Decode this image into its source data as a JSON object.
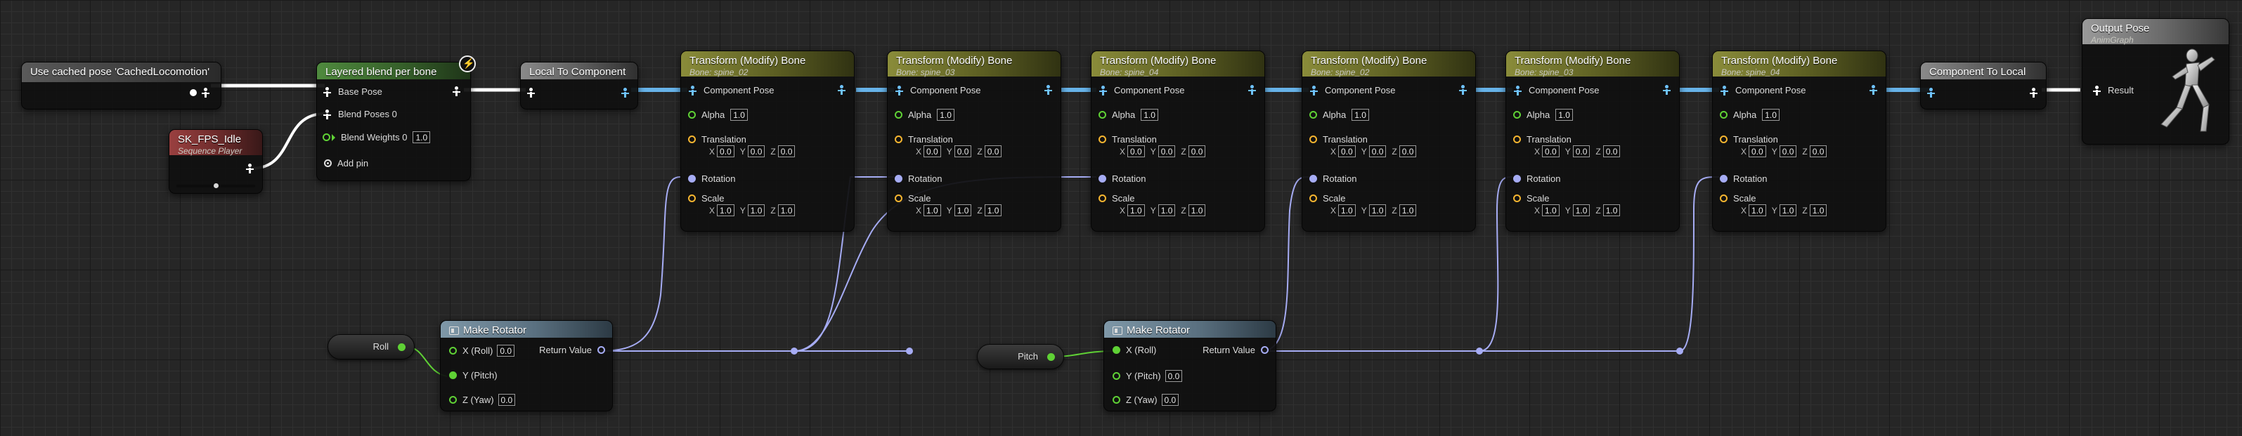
{
  "use_cached": {
    "title": "Use cached pose 'CachedLocomotion'"
  },
  "sequence_player": {
    "title": "SK_FPS_Idle",
    "subtitle": "Sequence Player",
    "play_position": 0.5
  },
  "layered_blend": {
    "title": "Layered blend per bone",
    "base_pose": "Base Pose",
    "blend_poses": "Blend Poses 0",
    "blend_weights": "Blend Weights 0",
    "blend_weights_value": "1.0",
    "add_pin": "Add pin"
  },
  "local_to_component": {
    "title": "Local To Component"
  },
  "component_to_local": {
    "title": "Component To Local"
  },
  "output_pose": {
    "title": "Output Pose",
    "subtitle": "AnimGraph",
    "result": "Result"
  },
  "transform_labels": {
    "component_pose": "Component Pose",
    "alpha": "Alpha",
    "translation": "Translation",
    "rotation": "Rotation",
    "scale": "Scale",
    "x": "X",
    "y": "Y",
    "z": "Z"
  },
  "transform_nodes": [
    {
      "title": "Transform (Modify) Bone",
      "bone": "Bone: spine_02",
      "alpha": "1.0",
      "translation": [
        "0.0",
        "0.0",
        "0.0"
      ],
      "scale": [
        "1.0",
        "1.0",
        "1.0"
      ]
    },
    {
      "title": "Transform (Modify) Bone",
      "bone": "Bone: spine_03",
      "alpha": "1.0",
      "translation": [
        "0.0",
        "0.0",
        "0.0"
      ],
      "scale": [
        "1.0",
        "1.0",
        "1.0"
      ]
    },
    {
      "title": "Transform (Modify) Bone",
      "bone": "Bone: spine_04",
      "alpha": "1.0",
      "translation": [
        "0.0",
        "0.0",
        "0.0"
      ],
      "scale": [
        "1.0",
        "1.0",
        "1.0"
      ]
    },
    {
      "title": "Transform (Modify) Bone",
      "bone": "Bone: spine_02",
      "alpha": "1.0",
      "translation": [
        "0.0",
        "0.0",
        "0.0"
      ],
      "scale": [
        "1.0",
        "1.0",
        "1.0"
      ]
    },
    {
      "title": "Transform (Modify) Bone",
      "bone": "Bone: spine_03",
      "alpha": "1.0",
      "translation": [
        "0.0",
        "0.0",
        "0.0"
      ],
      "scale": [
        "1.0",
        "1.0",
        "1.0"
      ]
    },
    {
      "title": "Transform (Modify) Bone",
      "bone": "Bone: spine_04",
      "alpha": "1.0",
      "translation": [
        "0.0",
        "0.0",
        "0.0"
      ],
      "scale": [
        "1.0",
        "1.0",
        "1.0"
      ]
    }
  ],
  "make_rotator_1": {
    "title": "Make Rotator",
    "x": "X (Roll)",
    "x_value": "0.0",
    "y": "Y (Pitch)",
    "z": "Z (Yaw)",
    "z_value": "0.0",
    "return": "Return Value"
  },
  "make_rotator_2": {
    "title": "Make Rotator",
    "x": "X (Roll)",
    "y": "Y (Pitch)",
    "y_value": "0.0",
    "z": "Z (Yaw)",
    "z_value": "0.0",
    "return": "Return Value"
  },
  "var_roll": {
    "label": "Roll"
  },
  "var_pitch": {
    "label": "Pitch"
  },
  "colors": {
    "pose_wire": "#6fc3ff",
    "exec_wire": "#ffffff",
    "rotator_wire": "#a6acf4",
    "float_wire": "#5fd135"
  },
  "icons": {
    "bolt": "lightning-bolt-icon",
    "pose": "pose-figure-icon",
    "add": "add-pin-icon",
    "mannequin": "mannequin-icon"
  }
}
